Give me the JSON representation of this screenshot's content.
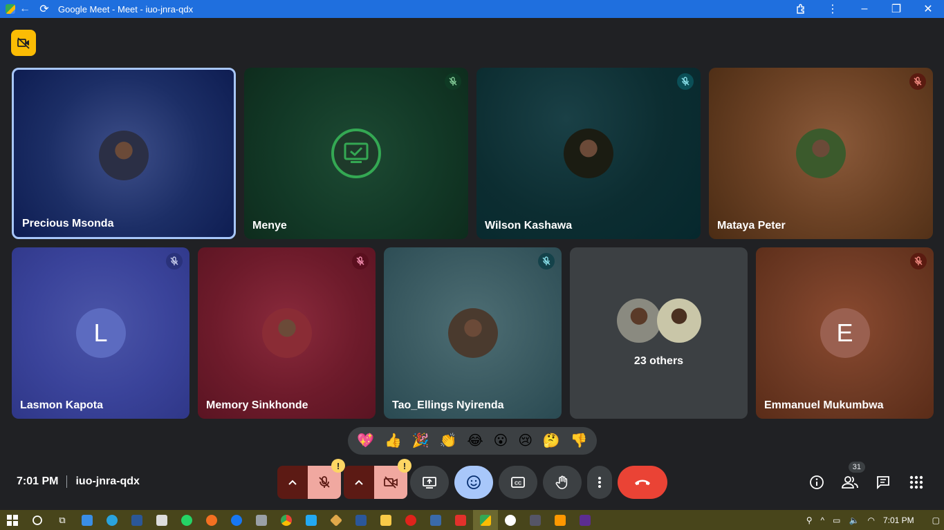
{
  "window": {
    "title": "Google Meet - Meet - iuo-jnra-qdx"
  },
  "top_row": [
    {
      "name": "Precious Msonda",
      "bg": "radial-gradient(circle at 50% 50%, #3e4f8a 0%, #1c2e66 55%, #0e1d52 100%)",
      "muted": false,
      "selected": true,
      "avatar": "photo",
      "avatar_color": "#2b2f45"
    },
    {
      "name": "Menye",
      "bg": "radial-gradient(circle at 50% 50%, #1d4a33 0%, #123826 60%, #0e2c1d 100%)",
      "muted": true,
      "mic_bg": "#0f3a24",
      "mic_color": "#81c995",
      "avatar": "screen",
      "avatar_color": "#1e3a2a"
    },
    {
      "name": "Wilson Kashawa",
      "bg": "radial-gradient(circle at 40% 30%, #1a4046 0%, #0c2d31 55%, #06282d 100%)",
      "muted": true,
      "mic_bg": "#0b4f57",
      "mic_color": "#8ae0ea",
      "avatar": "photo",
      "avatar_color": "#1b1c12"
    },
    {
      "name": "Mataya Peter",
      "bg": "radial-gradient(circle at 55% 45%, #8b5a3a 0%, #6b4124 50%, #4b2c14 100%)",
      "muted": true,
      "mic_bg": "#5a1b10",
      "mic_color": "#f28b82",
      "avatar": "photo",
      "avatar_color": "#3b5a2c"
    }
  ],
  "bottom_row": [
    {
      "name": "Lasmon Kapota",
      "bg": "radial-gradient(circle at 50% 45%, #4b55a8 0%, #3a439a 55%, #2f3788 100%)",
      "muted": true,
      "mic_bg": "#2a327b",
      "mic_color": "#c5cae9",
      "avatar": "letter",
      "letter": "L",
      "avatar_color": "#5c6bc0"
    },
    {
      "name": "Memory Sinkhonde",
      "bg": "radial-gradient(circle at 50% 45%, #8a2a3c 0%, #6e1b2b 55%, #5a1422 100%)",
      "muted": true,
      "mic_bg": "#5a0f1e",
      "mic_color": "#f48fb1",
      "avatar": "photo",
      "avatar_color": "#8a2c35"
    },
    {
      "name": "Tao_Ellings Nyirenda",
      "bg": "radial-gradient(circle at 50% 45%, #4e6e74 0%, #3a5a61 55%, #2a4a52 100%)",
      "muted": true,
      "mic_bg": "#14424a",
      "mic_color": "#8ae0ea",
      "avatar": "photo",
      "avatar_color": "#4a3a2e"
    },
    {
      "name": "",
      "others_label": "23 others",
      "bg": "#3c4043",
      "muted": false,
      "avatar": "group"
    },
    {
      "name": "Emmanuel Mukumbwa",
      "bg": "radial-gradient(circle at 50% 45%, #8b4a30 0%, #6e3a24 55%, #5a2c18 100%)",
      "muted": true,
      "mic_bg": "#5a1b10",
      "mic_color": "#f28b82",
      "avatar": "letter",
      "letter": "E",
      "avatar_color": "#9a6050"
    }
  ],
  "reactions": [
    "💖",
    "👍",
    "🎉",
    "👏",
    "😂",
    "😮",
    "😢",
    "🤔",
    "👎"
  ],
  "meeting": {
    "time": "7:01 PM",
    "code": "iuo-jnra-qdx"
  },
  "participants_count": "31",
  "taskbar": {
    "clock": "7:01 PM"
  },
  "colors": {
    "accent": "#a8c7fa",
    "end_call": "#ea4335",
    "muted_red": "#f28b82",
    "warning": "#fdd663"
  }
}
